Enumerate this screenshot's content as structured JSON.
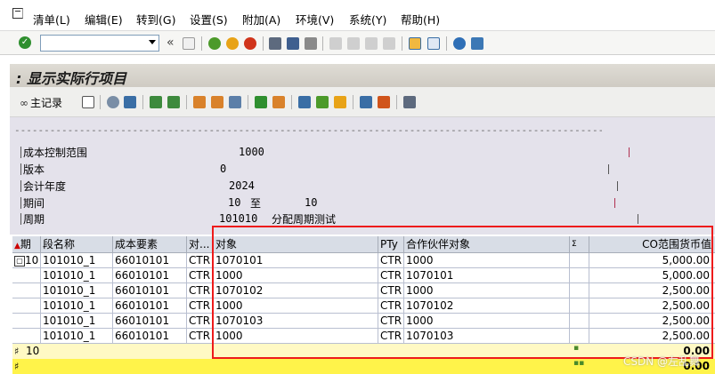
{
  "menu": {
    "items": [
      "清单(L)",
      "编辑(E)",
      "转到(G)",
      "设置(S)",
      "附加(A)",
      "环境(V)",
      "系统(Y)",
      "帮助(H)"
    ]
  },
  "toolbar": {
    "command_value": "",
    "nav_back_label": "«"
  },
  "title": ": 显示实际行项目",
  "apptoolbar": {
    "main_record_label": "主记录"
  },
  "header": {
    "dashes": "------------------------------------------------------------------------------------------------------------------------",
    "rows": [
      {
        "label": "成本控制范围",
        "value": "1000"
      },
      {
        "label": "版本",
        "value": "0"
      },
      {
        "label": "会计年度",
        "value": "2024"
      },
      {
        "label": "期间",
        "value": "10",
        "to_label": "至",
        "to_value": "10"
      },
      {
        "label": "周期",
        "value": "101010",
        "extra": "分配周期测试"
      }
    ]
  },
  "table": {
    "columns": [
      "期",
      "段名称",
      "成本要素",
      "对...",
      "对象",
      "PTy",
      "合作伙伴对象",
      "Σ",
      "CO范围货币值"
    ],
    "rows": [
      {
        "period": "10",
        "segment": "101010_1",
        "cost_element": "66010101",
        "obj_type": "CTR",
        "object": "1070101",
        "pty": "CTR",
        "partner": "1000",
        "value": "5,000.00"
      },
      {
        "period": "",
        "segment": "101010_1",
        "cost_element": "66010101",
        "obj_type": "CTR",
        "object": "1000",
        "pty": "CTR",
        "partner": "1070101",
        "value": "5,000.00"
      },
      {
        "period": "",
        "segment": "101010_1",
        "cost_element": "66010101",
        "obj_type": "CTR",
        "object": "1070102",
        "pty": "CTR",
        "partner": "1000",
        "value": "2,500.00"
      },
      {
        "period": "",
        "segment": "101010_1",
        "cost_element": "66010101",
        "obj_type": "CTR",
        "object": "1000",
        "pty": "CTR",
        "partner": "1070102",
        "value": "2,500.00"
      },
      {
        "period": "",
        "segment": "101010_1",
        "cost_element": "66010101",
        "obj_type": "CTR",
        "object": "1070103",
        "pty": "CTR",
        "partner": "1000",
        "value": "2,500.00"
      },
      {
        "period": "",
        "segment": "101010_1",
        "cost_element": "66010101",
        "obj_type": "CTR",
        "object": "1000",
        "pty": "CTR",
        "partner": "1070103",
        "value": "2,500.00"
      }
    ],
    "subtotal": {
      "period": "10",
      "marker": "▪",
      "value": "0.00"
    },
    "total": {
      "marker": "▪▪",
      "value": "0.00"
    }
  },
  "watermark": "CSDN @左乱舞",
  "colors": {
    "highlight_box": "#ee1b1b",
    "subtotal_bg": "#fff9c4",
    "total_bg": "#fff34a"
  }
}
